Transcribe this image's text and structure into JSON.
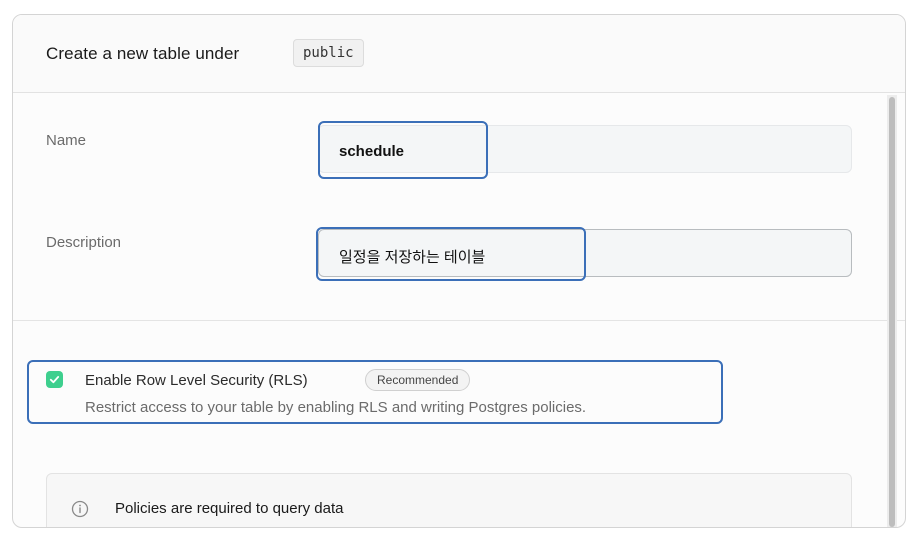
{
  "header": {
    "title": "Create a new table under",
    "schema": "public"
  },
  "name_field": {
    "label": "Name",
    "value": "schedule"
  },
  "description_field": {
    "label": "Description",
    "value": "일정을 저장하는 테이블"
  },
  "rls": {
    "checked": true,
    "label": "Enable Row Level Security (RLS)",
    "badge": "Recommended",
    "description": "Restrict access to your table by enabling RLS and writing Postgres policies."
  },
  "policy_notice": {
    "icon": "info-icon",
    "title": "Policies are required to query data"
  },
  "colors": {
    "highlight": "#3b6fb8",
    "checkbox": "#3ecf8e"
  }
}
